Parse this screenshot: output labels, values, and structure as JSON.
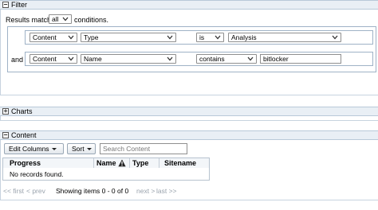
{
  "filter": {
    "title": "Filter",
    "toggle": "−",
    "match_prefix": "Results match",
    "match_value": "all",
    "match_suffix": "conditions.",
    "conditions": [
      {
        "joiner": "",
        "field_group": "Content",
        "field": "Type",
        "operator": "is",
        "value": "Analysis"
      },
      {
        "joiner": "and",
        "field_group": "Content",
        "field": "Name",
        "operator": "contains",
        "value": "bitlocker"
      }
    ]
  },
  "charts": {
    "title": "Charts",
    "toggle": "+"
  },
  "content": {
    "title": "Content",
    "toggle": "−",
    "edit_columns_label": "Edit Columns",
    "sort_label": "Sort",
    "search_placeholder": "Search Content",
    "columns": [
      "Progress",
      "Name",
      "Type",
      "Sitename"
    ],
    "empty_message": "No records found.",
    "pager": {
      "first": "<< first",
      "prev": "< prev",
      "status": "Showing items 0 - 0 of 0",
      "next": "next >",
      "last": "last >>"
    }
  },
  "icons": {
    "warning": "warning-triangle-icon",
    "chevron": "chevron-down-icon",
    "caret": "caret-down-icon"
  },
  "colors": {
    "header_bg": "#e9eff5",
    "border": "#b9c9d9",
    "pager_disabled": "#9aa3ad"
  }
}
